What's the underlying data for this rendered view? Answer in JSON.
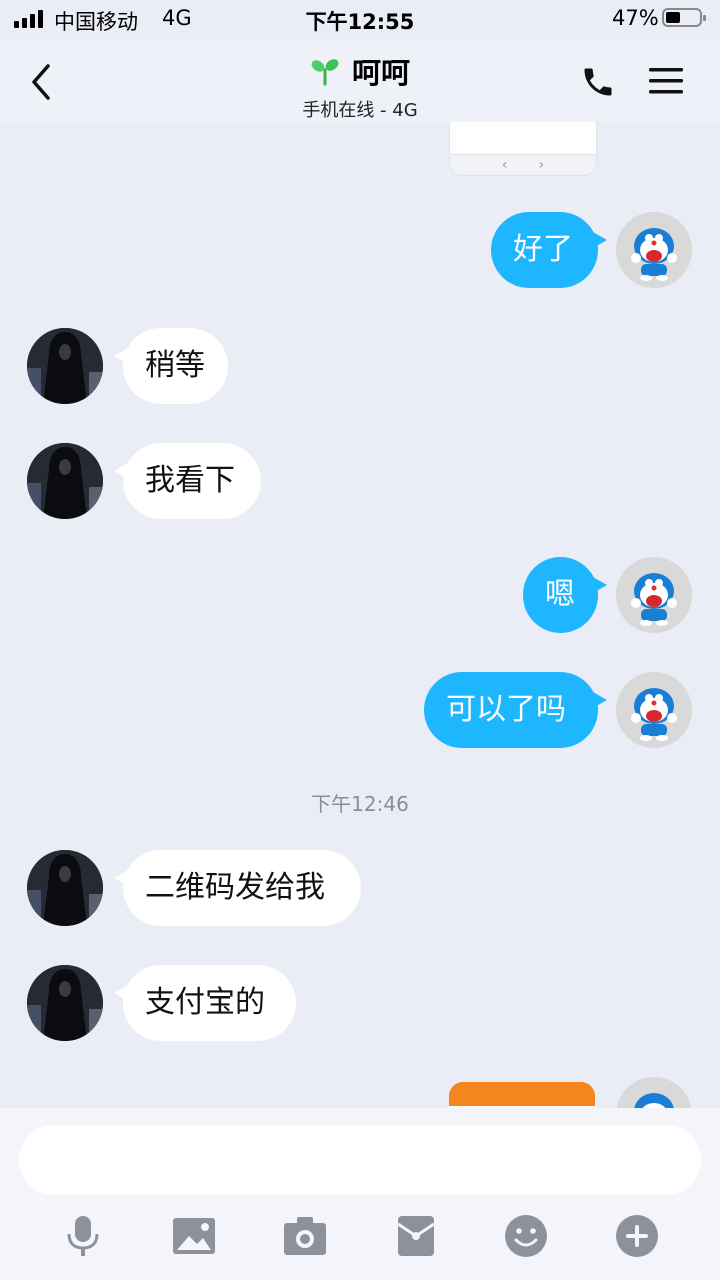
{
  "status_bar": {
    "carrier": "中国移动",
    "network": "4G",
    "time": "下午12:55",
    "battery_percent": "47%",
    "battery_level": 0.47
  },
  "header": {
    "contact_name": "呵呵",
    "presence": "手机在线 - 4G"
  },
  "chat": {
    "top_image_nav": {
      "prev": "‹",
      "next": "›"
    },
    "messages": [
      {
        "from": "me",
        "text": "好了"
      },
      {
        "from": "them",
        "text": "稍等"
      },
      {
        "from": "them",
        "text": "我看下"
      },
      {
        "from": "me",
        "text": "嗯"
      },
      {
        "from": "me",
        "text": "可以了吗"
      },
      {
        "from": "them",
        "text": "二维码发给我"
      },
      {
        "from": "them",
        "text": "支付宝的"
      }
    ],
    "timestamp": "下午12:46"
  },
  "composer": {
    "value": "",
    "placeholder": ""
  },
  "colors": {
    "background": "#eaedf6",
    "my_bubble": "#1eb7ff",
    "their_bubble": "#ffffff",
    "icon_gray": "#8e919c",
    "image_orange": "#f5861f"
  },
  "icons": [
    "back-icon",
    "sprout-icon",
    "phone-icon",
    "menu-icon",
    "microphone-icon",
    "image-icon",
    "camera-icon",
    "red-packet-icon",
    "emoji-icon",
    "plus-icon"
  ]
}
